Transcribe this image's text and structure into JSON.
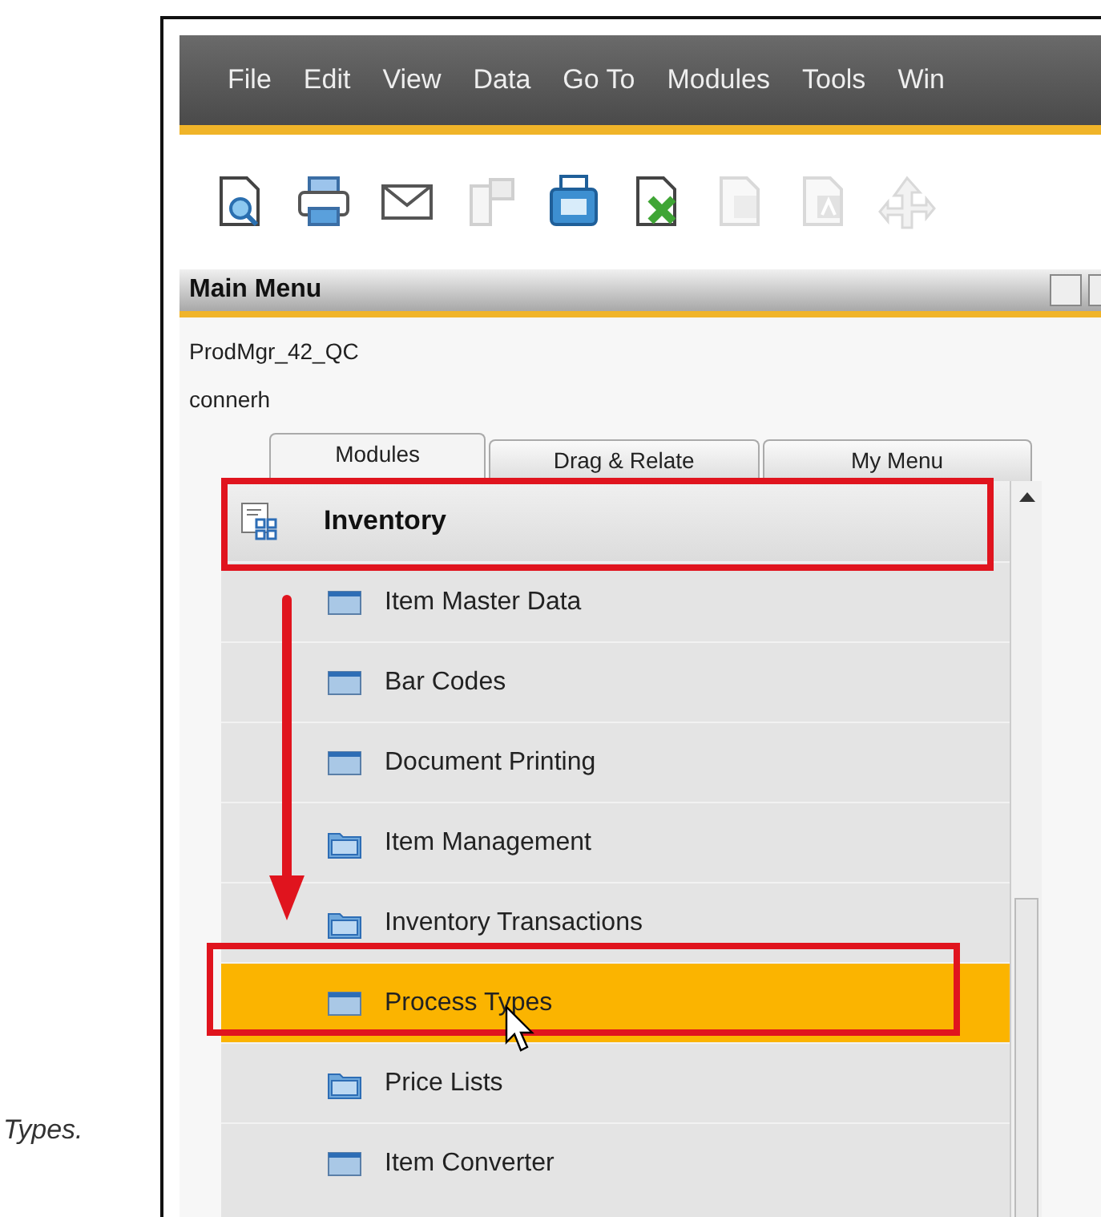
{
  "caption_fragment": "Types.",
  "app": {
    "menu_bar": [
      "File",
      "Edit",
      "View",
      "Data",
      "Go To",
      "Modules",
      "Tools",
      "Win"
    ],
    "toolbar": [
      {
        "kind": "preview",
        "disabled": false
      },
      {
        "kind": "print",
        "disabled": false
      },
      {
        "kind": "email",
        "disabled": false
      },
      {
        "kind": "transfer",
        "disabled": true
      },
      {
        "kind": "fax",
        "disabled": false
      },
      {
        "kind": "excel",
        "disabled": false
      },
      {
        "kind": "word",
        "disabled": true
      },
      {
        "kind": "pdf",
        "disabled": true
      },
      {
        "kind": "navigate",
        "disabled": true
      }
    ],
    "main_menu": {
      "title": "Main Menu",
      "company": "ProdMgr_42_QC",
      "user": "connerh",
      "tabs": [
        {
          "label": "Modules",
          "selected": true
        },
        {
          "label": "Drag & Relate",
          "selected": false
        },
        {
          "label": "My Menu",
          "selected": false
        }
      ],
      "module": "Inventory",
      "items": [
        {
          "label": "Item Master Data",
          "kind": "form",
          "selected": false
        },
        {
          "label": "Bar Codes",
          "kind": "form",
          "selected": false
        },
        {
          "label": "Document Printing",
          "kind": "form",
          "selected": false
        },
        {
          "label": "Item Management",
          "kind": "folder",
          "selected": false
        },
        {
          "label": "Inventory Transactions",
          "kind": "folder",
          "selected": false
        },
        {
          "label": "Process Types",
          "kind": "form",
          "selected": true
        },
        {
          "label": "Price Lists",
          "kind": "folder",
          "selected": false
        },
        {
          "label": "Item Converter",
          "kind": "form",
          "selected": false
        }
      ]
    }
  }
}
